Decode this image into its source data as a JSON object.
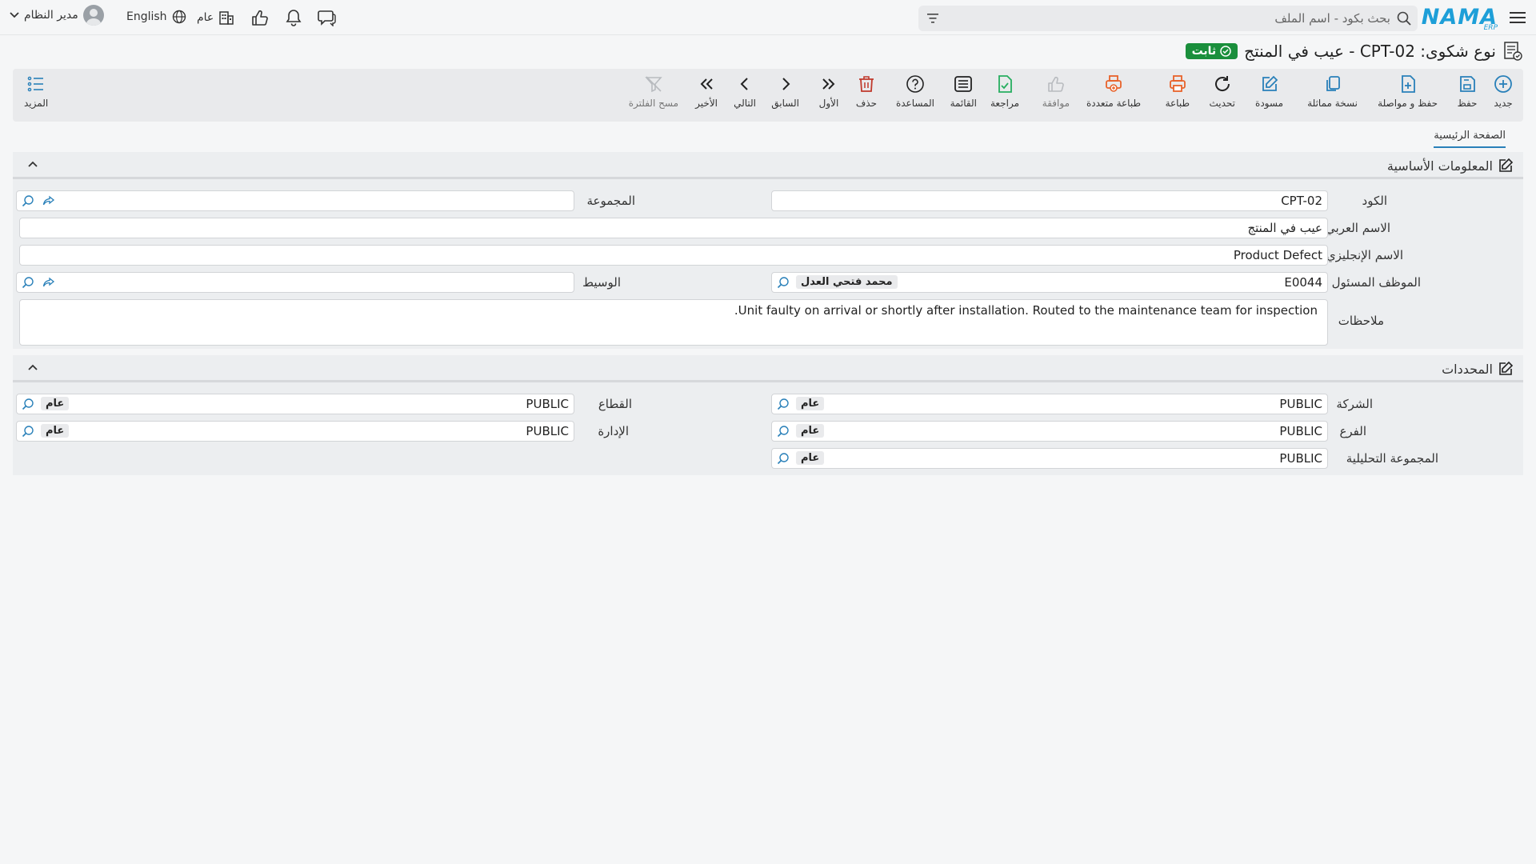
{
  "topbar": {
    "logo_text": "NAMA",
    "logo_sub": "ERP",
    "search_placeholder": "بحث بكود - اسم الملف",
    "language": "English",
    "public_label": "عام",
    "user_name": "مدير النظام"
  },
  "page": {
    "title": "نوع شكوى: CPT-02 - عيب في المنتج",
    "status_badge": "ثابت"
  },
  "toolbar": {
    "new": "جديد",
    "save": "حفظ",
    "save_continue": "حفظ و مواصلة",
    "duplicate": "نسخة مماثلة",
    "draft": "مسودة",
    "refresh": "تحديث",
    "print": "طباعة",
    "multi_print": "طباعة متعددة",
    "approve": "موافقة",
    "review": "مراجعة",
    "list": "القائمة",
    "help": "المساعدة",
    "delete": "حذف",
    "first": "الأول",
    "previous": "السابق",
    "next": "التالي",
    "last": "الأخير",
    "clear_filter": "مسح الفلترة",
    "more": "المزيد"
  },
  "tabs": {
    "main": "الصفحة الرئيسية"
  },
  "basic_info": {
    "title": "المعلومات الأساسية",
    "code_label": "الكود",
    "code_value": "CPT-02",
    "group_label": "المجموعة",
    "group_value": "",
    "arabic_name_label": "الاسم العربي",
    "arabic_name_value": "عيب في المنتج",
    "english_name_label": "الاسم الإنجليزي",
    "english_name_value": "Product Defect",
    "employee_label": "الموظف المسئول",
    "employee_code": "E0044",
    "employee_name": "محمد فتحي العدل",
    "broker_label": "الوسيط",
    "broker_value": "",
    "notes_label": "ملاحظات",
    "notes_value": "Unit faulty on arrival or shortly after installation. Routed to the maintenance team for inspection."
  },
  "dimensions": {
    "title": "المحددات",
    "company_label": "الشركة",
    "company_code": "PUBLIC",
    "company_name": "عام",
    "sector_label": "القطاع",
    "sector_code": "PUBLIC",
    "sector_name": "عام",
    "branch_label": "الفرع",
    "branch_code": "PUBLIC",
    "branch_name": "عام",
    "department_label": "الإدارة",
    "department_code": "PUBLIC",
    "department_name": "عام",
    "analytic_group_label": "المجموعة التحليلية",
    "analytic_group_code": "PUBLIC",
    "analytic_group_name": "عام"
  },
  "colors": {
    "accent": "#2980b9",
    "status_green": "#1a8f3c",
    "print_orange": "#e8622a",
    "delete_red": "#c0392b",
    "review_green": "#27ae60"
  }
}
